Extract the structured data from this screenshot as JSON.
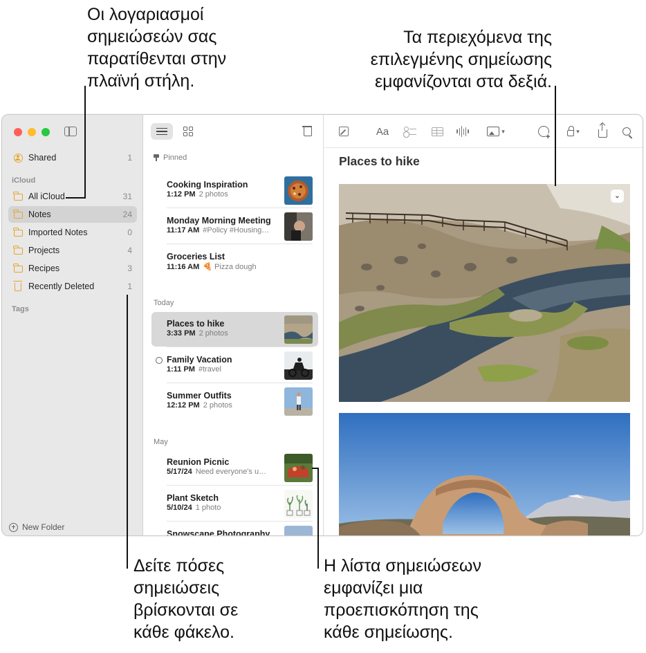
{
  "callouts": {
    "top_left": "Οι λογαριασμοί\nσημειώσεών σας\nπαρατίθενται στην\nπλαϊνή στήλη.",
    "top_right": "Τα περιεχόμενα της\nεπιλεγμένης σημείωσης\nεμφανίζονται στα δεξιά.",
    "bottom_left": "Δείτε πόσες\nσημειώσεις\nβρίσκονται σε\nκάθε φάκελο.",
    "bottom_right": "Η λίστα σημειώσεων\nεμφανίζει μια\nπροεπισκόπηση της\nκάθε σημείωσης."
  },
  "colors": {
    "accent": "#e8a52a",
    "selection": "#d8d8d8",
    "sidebar_bg": "#e8e8e8"
  },
  "sidebar": {
    "shared": {
      "label": "Shared",
      "count": "1",
      "icon": "person-circle-icon"
    },
    "icloud_header": "iCloud",
    "folders": [
      {
        "label": "All iCloud",
        "count": "31"
      },
      {
        "label": "Notes",
        "count": "24",
        "selected": true
      },
      {
        "label": "Imported Notes",
        "count": "0"
      },
      {
        "label": "Projects",
        "count": "4"
      },
      {
        "label": "Recipes",
        "count": "3"
      },
      {
        "label": "Recently Deleted",
        "count": "1"
      }
    ],
    "tags_header": "Tags",
    "new_folder": "New Folder"
  },
  "notelist": {
    "sections": {
      "pinned": "Pinned",
      "today": "Today",
      "may": "May"
    },
    "notes": [
      {
        "title": "Cooking Inspiration",
        "time": "1:12 PM",
        "preview": "2 photos"
      },
      {
        "title": "Monday Morning Meeting",
        "time": "11:17 AM",
        "preview": "#Policy #Housing…"
      },
      {
        "title": "Groceries List",
        "time": "11:16 AM",
        "preview": "🍕 Pizza dough"
      },
      {
        "title": "Places to hike",
        "time": "3:33 PM",
        "preview": "2 photos",
        "selected": true
      },
      {
        "title": "Family Vacation",
        "time": "1:11 PM",
        "preview": "#travel",
        "shared": true
      },
      {
        "title": "Summer Outfits",
        "time": "12:12 PM",
        "preview": "2 photos"
      },
      {
        "title": "Reunion Picnic",
        "time": "5/17/24",
        "preview": "Need everyone's u…"
      },
      {
        "title": "Plant Sketch",
        "time": "5/10/24",
        "preview": "1 photo"
      },
      {
        "title": "Snowscape Photography",
        "time": "",
        "preview": ""
      }
    ]
  },
  "detail": {
    "title": "Places to hike",
    "toolbar": {
      "format_label": "Aa"
    }
  }
}
